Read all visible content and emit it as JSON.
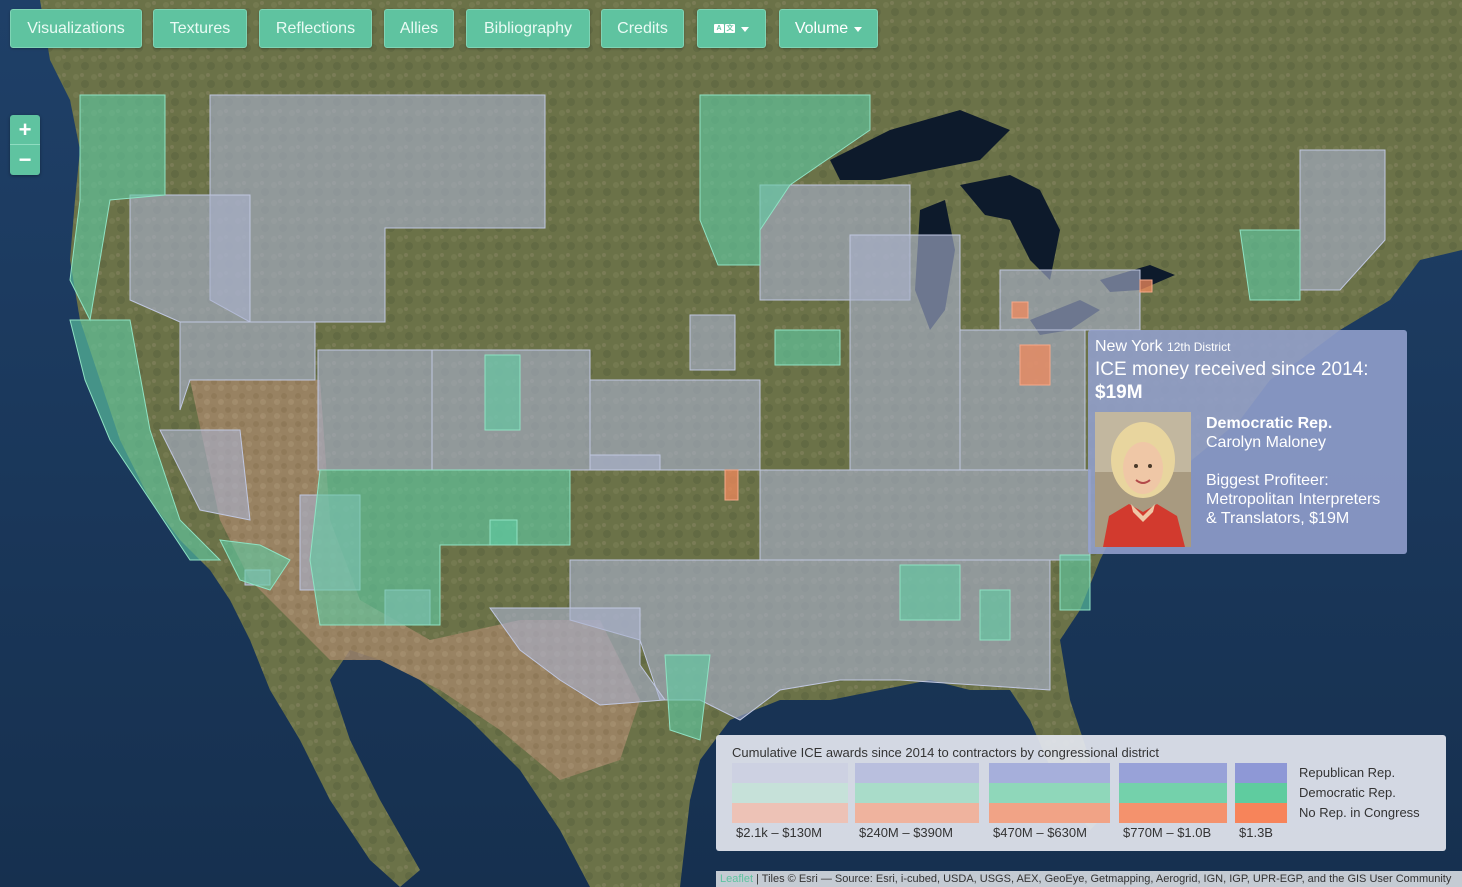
{
  "nav": {
    "items": [
      {
        "label": "Visualizations"
      },
      {
        "label": "Textures"
      },
      {
        "label": "Reflections"
      },
      {
        "label": "Allies"
      },
      {
        "label": "Bibliography"
      },
      {
        "label": "Credits"
      }
    ],
    "language_icon": "translate-icon",
    "volume_label": "Volume"
  },
  "zoom": {
    "in_label": "+",
    "out_label": "−"
  },
  "popup": {
    "district_name": "New York",
    "district_number": "12th District",
    "money_label": "ICE money received since 2014:",
    "money_value": "$19M",
    "party": "Democratic Rep.",
    "representative": "Carolyn Maloney",
    "profiteer_label": "Biggest Profiteer:",
    "profiteer_line1": "Metropolitan Interpreters",
    "profiteer_line2": "& Translators, $19M"
  },
  "legend": {
    "title": "Cumulative ICE awards since 2014 to contractors by congressional district",
    "ranges": [
      "$2.1k – $130M",
      "$240M – $390M",
      "$470M – $630M",
      "$770M – $1.0B",
      "$1.3B"
    ],
    "keys": [
      "Republican Rep.",
      "Democratic Rep.",
      "No Rep. in Congress"
    ],
    "colors": {
      "republican": [
        "#cdd1e2",
        "#b9bfde",
        "#a6afdb",
        "#98a2d8",
        "#8e98d6"
      ],
      "democratic": [
        "#c6e1d9",
        "#a9dcc9",
        "#8fd7ba",
        "#74d1ab",
        "#5fcc9f"
      ],
      "none": [
        "#edc2b6",
        "#efb39e",
        "#f1a386",
        "#f4926d",
        "#f7845a"
      ]
    }
  },
  "attribution": {
    "leaflet": "Leaflet",
    "text": " | Tiles © Esri — Source: Esri, i-cubed, USDA, USGS, AEX, GeoEye, Getmapping, Aerogrid, IGN, IGP, UPR-EGP, and the GIS User Community"
  }
}
